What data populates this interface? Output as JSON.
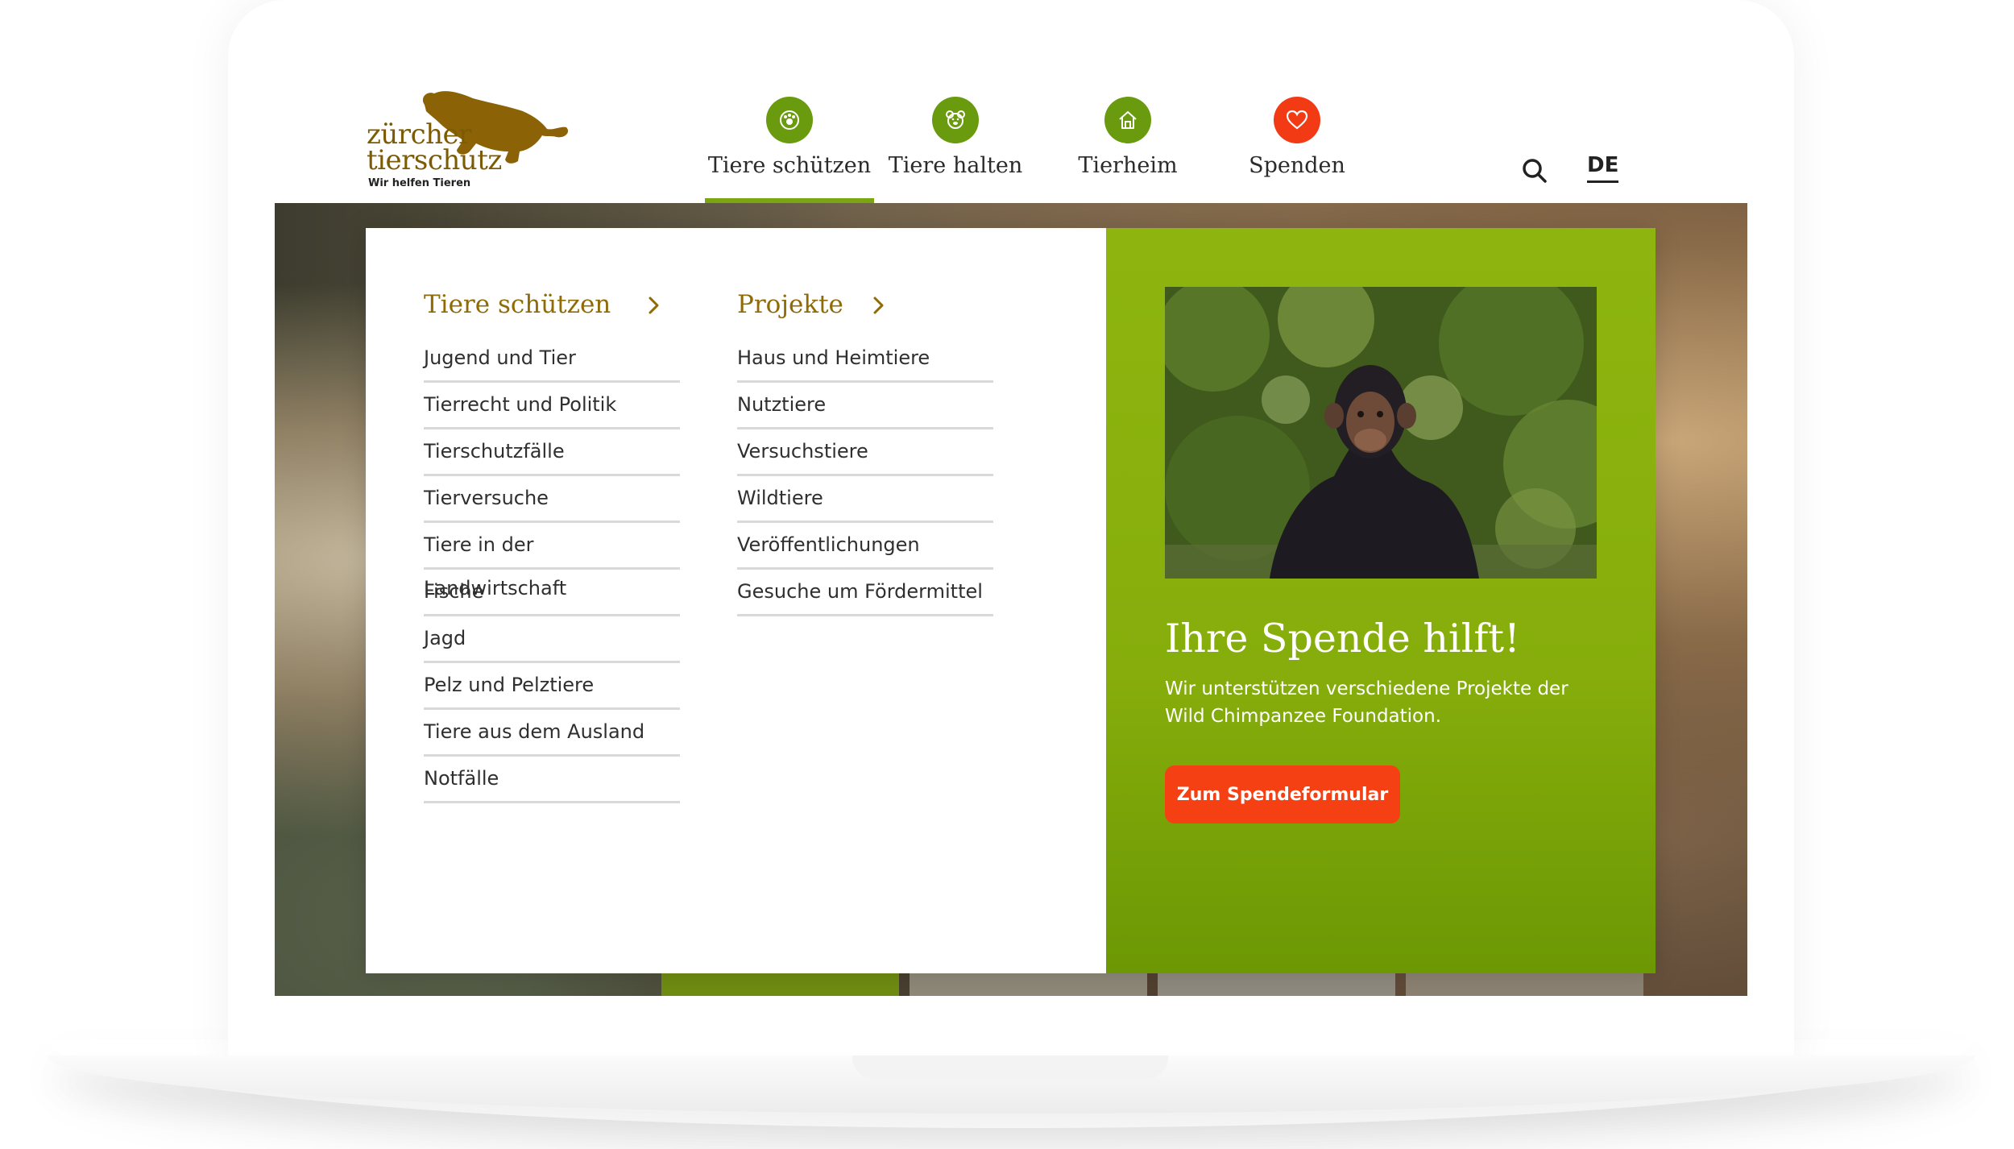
{
  "header": {
    "logo": {
      "line1": "zürcher",
      "line2": "tierschutz",
      "tagline": "Wir helfen Tieren"
    },
    "nav": [
      {
        "label": "Tiere schützen",
        "icon": "paw-target-icon",
        "active": true
      },
      {
        "label": "Tiere halten",
        "icon": "bear-face-icon",
        "active": false
      },
      {
        "label": "Tierheim",
        "icon": "house-icon",
        "active": false
      },
      {
        "label": "Spenden",
        "icon": "heart-icon",
        "active": false
      }
    ],
    "language": "DE"
  },
  "mega_menu": {
    "column1": {
      "heading": "Tiere schützen",
      "items": [
        "Jugend und Tier",
        "Tierrecht und Politik",
        "Tierschutzfälle",
        "Tierversuche",
        "Tiere in der Landwirtschaft",
        "Fische",
        "Jagd",
        "Pelz und Pelztiere",
        "Tiere aus dem Ausland",
        "Notfälle"
      ]
    },
    "column2": {
      "heading": "Projekte",
      "items": [
        "Haus und Heimtiere",
        "Nutztiere",
        "Versuchstiere",
        "Wildtiere",
        "Veröffentlichungen",
        "Gesuche um Fördermittel"
      ]
    },
    "promo": {
      "title": "Ihre Spende hilft!",
      "text": "Wir unterstützen verschiedene Projekte der Wild Chimpanzee Foundation.",
      "button": "Zum Spendeformular"
    }
  },
  "colors": {
    "brand_brown": "#7d5b05",
    "heading_gold": "#8f6a05",
    "nav_green": "#6a9a0e",
    "promo_green": "#8eb50f",
    "donate_red": "#f23a14",
    "button_orange": "#f54013"
  }
}
